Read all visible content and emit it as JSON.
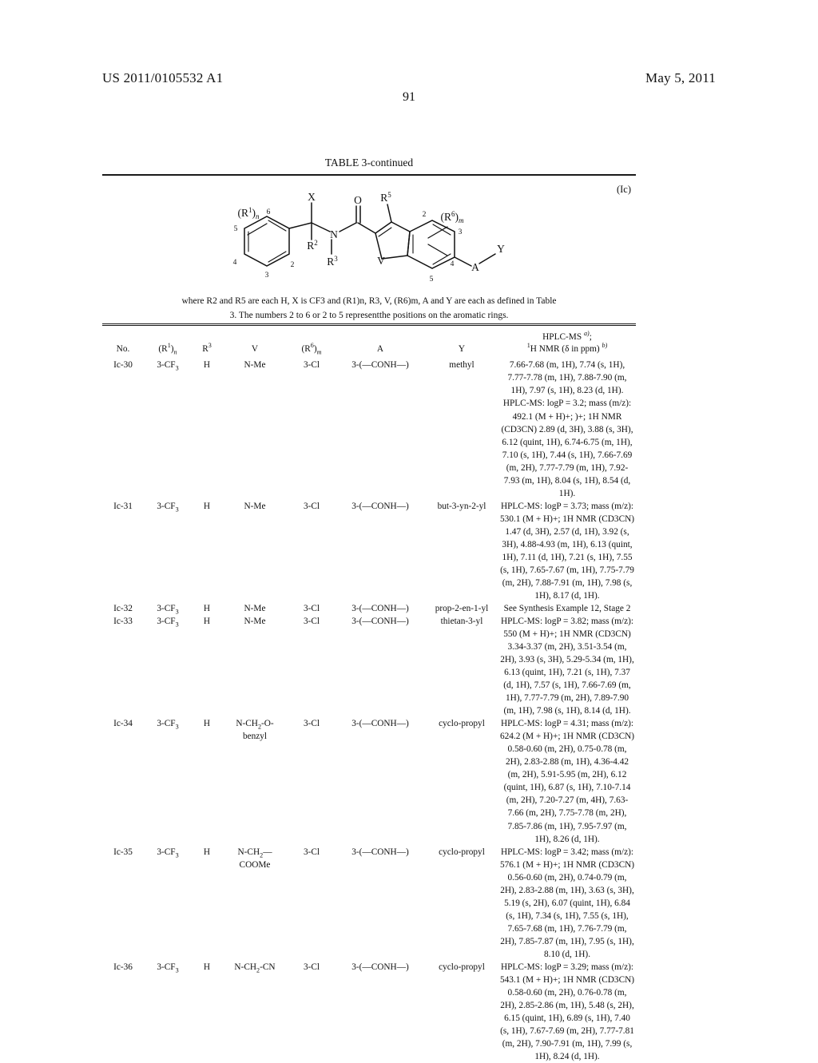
{
  "header": {
    "publication_number": "US 2011/0105532 A1",
    "date": "May 5, 2011",
    "page_number": "91"
  },
  "table": {
    "caption": "TABLE 3-continued",
    "formula_tag": "(Ic)",
    "note_line_1": "where R2 and R5 are each H, X is CF3 and (R1)n, R3, V, (R6)m, A and Y are each as defined in Table",
    "note_line_2": "3. The numbers 2 to 6 or 2 to 5 representthe positions on the aromatic rings.",
    "columns": [
      "No.",
      "(R1)n",
      "R3",
      "V",
      "(R6)m",
      "A",
      "Y",
      "HPLC-MS a); 1H NMR (δ in ppm) b)"
    ],
    "header_data_line_1": "HPLC-MS",
    "header_data_sup_1": "a)",
    "header_data_semicolon": ";",
    "header_data_line_2a": "H NMR (δ in ppm)",
    "header_data_sup_2": "b)",
    "rows": [
      {
        "no": "Ic-30",
        "r1": "3-CF3",
        "r3": "H",
        "v": "N-Me",
        "v2": "",
        "r6": "3-Cl",
        "a": "3-(—CONH—)",
        "y": "methyl",
        "data": "7.66-7.68 (m, 1H), 7.74 (s, 1H), 7.77-7.78 (m, 1H), 7.88-7.90 (m, 1H), 7.97 (s, 1H), 8.23 (d, 1H). HPLC-MS: logP = 3.2; mass (m/z): 492.1 (M + H)+; )+; 1H NMR (CD3CN) 2.89 (d, 3H), 3.88 (s, 3H), 6.12 (quint, 1H), 6.74-6.75 (m, 1H), 7.10 (s, 1H), 7.44 (s, 1H), 7.66-7.69 (m, 2H), 7.77-7.79 (m, 1H), 7.92-7.93 (m, 1H), 8.04 (s, 1H), 8.54 (d, 1H)."
      },
      {
        "no": "Ic-31",
        "r1": "3-CF3",
        "r3": "H",
        "v": "N-Me",
        "v2": "",
        "r6": "3-Cl",
        "a": "3-(—CONH—)",
        "y": "but-3-yn-2-yl",
        "data": "HPLC-MS: logP = 3.73; mass (m/z): 530.1 (M + H)+; 1H NMR (CD3CN) 1.47 (d, 3H), 2.57 (d, 1H), 3.92 (s, 3H), 4.88-4.93 (m, 1H), 6.13 (quint, 1H), 7.11 (d, 1H), 7.21 (s, 1H), 7.55 (s, 1H), 7.65-7.67 (m, 1H), 7.75-7.79 (m, 2H), 7.88-7.91 (m, 1H), 7.98 (s, 1H), 8.17 (d, 1H)."
      },
      {
        "no": "Ic-32",
        "r1": "3-CF3",
        "r3": "H",
        "v": "N-Me",
        "v2": "",
        "r6": "3-Cl",
        "a": "3-(—CONH—)",
        "y": "prop-2-en-1-yl",
        "data": "See Synthesis Example 12, Stage 2"
      },
      {
        "no": "Ic-33",
        "r1": "3-CF3",
        "r3": "H",
        "v": "N-Me",
        "v2": "",
        "r6": "3-Cl",
        "a": "3-(—CONH—)",
        "y": "thietan-3-yl",
        "data": "HPLC-MS: logP = 3.82; mass (m/z): 550 (M + H)+; 1H NMR (CD3CN) 3.34-3.37 (m, 2H), 3.51-3.54 (m, 2H), 3.93 (s, 3H), 5.29-5.34 (m, 1H), 6.13 (quint, 1H), 7.21 (s, 1H), 7.37 (d, 1H), 7.57 (s, 1H), 7.66-7.69 (m, 1H), 7.77-7.79 (m, 2H), 7.89-7.90 (m, 1H), 7.98 (s, 1H), 8.14 (d, 1H)."
      },
      {
        "no": "Ic-34",
        "r1": "3-CF3",
        "r3": "H",
        "v": "N-CH2-O-",
        "v2": "benzyl",
        "r6": "3-Cl",
        "a": "3-(—CONH—)",
        "y": "cyclo-propyl",
        "data": "HPLC-MS: logP = 4.31; mass (m/z): 624.2 (M + H)+; 1H NMR (CD3CN) 0.58-0.60 (m, 2H), 0.75-0.78 (m, 2H), 2.83-2.88 (m, 1H), 4.36-4.42 (m, 2H), 5.91-5.95 (m, 2H), 6.12 (quint, 1H), 6.87 (s, 1H), 7.10-7.14 (m, 2H), 7.20-7.27 (m, 4H), 7.63-7.66 (m, 2H), 7.75-7.78 (m, 2H), 7.85-7.86 (m, 1H), 7.95-7.97 (m, 1H), 8.26 (d, 1H)."
      },
      {
        "no": "Ic-35",
        "r1": "3-CF3",
        "r3": "H",
        "v": "N-CH2—",
        "v2": "COOMe",
        "r6": "3-Cl",
        "a": "3-(—CONH—)",
        "y": "cyclo-propyl",
        "data": "HPLC-MS: logP = 3.42; mass (m/z): 576.1 (M + H)+; 1H NMR (CD3CN) 0.56-0.60 (m, 2H), 0.74-0.79 (m, 2H), 2.83-2.88 (m, 1H), 3.63 (s, 3H), 5.19 (s, 2H), 6.07 (quint, 1H), 6.84 (s, 1H), 7.34 (s, 1H), 7.55 (s, 1H), 7.65-7.68 (m, 1H), 7.76-7.79 (m, 2H), 7.85-7.87 (m, 1H), 7.95 (s, 1H), 8.10 (d, 1H)."
      },
      {
        "no": "Ic-36",
        "r1": "3-CF3",
        "r3": "H",
        "v": "N-CH2-CN",
        "v2": "",
        "r6": "3-Cl",
        "a": "3-(—CONH—)",
        "y": "cyclo-propyl",
        "data": "HPLC-MS: logP = 3.29; mass (m/z): 543.1 (M + H)+; 1H NMR (CD3CN) 0.58-0.60 (m, 2H), 0.76-0.78 (m, 2H), 2.85-2.86 (m, 1H), 5.48 (s, 2H), 6.15 (quint, 1H), 6.89 (s, 1H), 7.40 (s, 1H), 7.67-7.69 (m, 2H), 7.77-7.81 (m, 2H), 7.90-7.91 (m, 1H), 7.99 (s, 1H), 8.24 (d, 1H)."
      }
    ]
  },
  "structure": {
    "labels": {
      "X": "X",
      "O": "O",
      "N": "N",
      "V": "V",
      "A": "A",
      "Y": "Y",
      "R1n": "(R1)n",
      "R2": "R2",
      "R3": "R3",
      "R5": "R5",
      "R6m": "(R6)m",
      "left_ring_positions": [
        "2",
        "3",
        "4",
        "5",
        "6"
      ],
      "right_ring_positions": [
        "2",
        "3",
        "4",
        "5"
      ]
    }
  }
}
